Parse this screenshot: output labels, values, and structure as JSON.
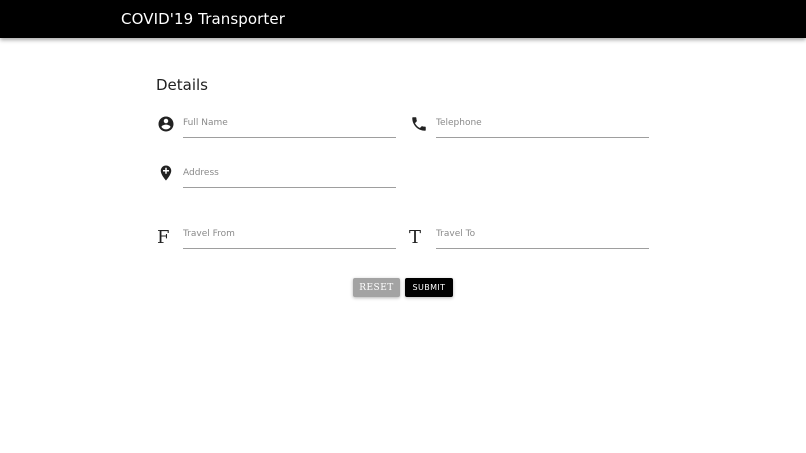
{
  "app": {
    "title": "COVID'19 Transporter"
  },
  "form": {
    "section_title": "Details",
    "fields": {
      "full_name": {
        "placeholder": "Full Name",
        "value": "",
        "icon": "account-circle-icon"
      },
      "telephone": {
        "placeholder": "Telephone",
        "value": "",
        "icon": "phone-icon"
      },
      "address": {
        "placeholder": "Address",
        "value": "",
        "icon": "add-location-icon"
      },
      "travel_from": {
        "placeholder": "Travel From",
        "value": "",
        "icon": "letter-f-icon",
        "icon_glyph": "F"
      },
      "travel_to": {
        "placeholder": "Travel To",
        "value": "",
        "icon": "letter-t-icon",
        "icon_glyph": "T"
      }
    },
    "buttons": {
      "reset_label": "RESET",
      "submit_label": "SUBMIT"
    }
  },
  "colors": {
    "app_bar": "#000000",
    "reset_button": "#a3a3a3",
    "submit_button": "#000000",
    "underline": "#9e9e9e"
  }
}
